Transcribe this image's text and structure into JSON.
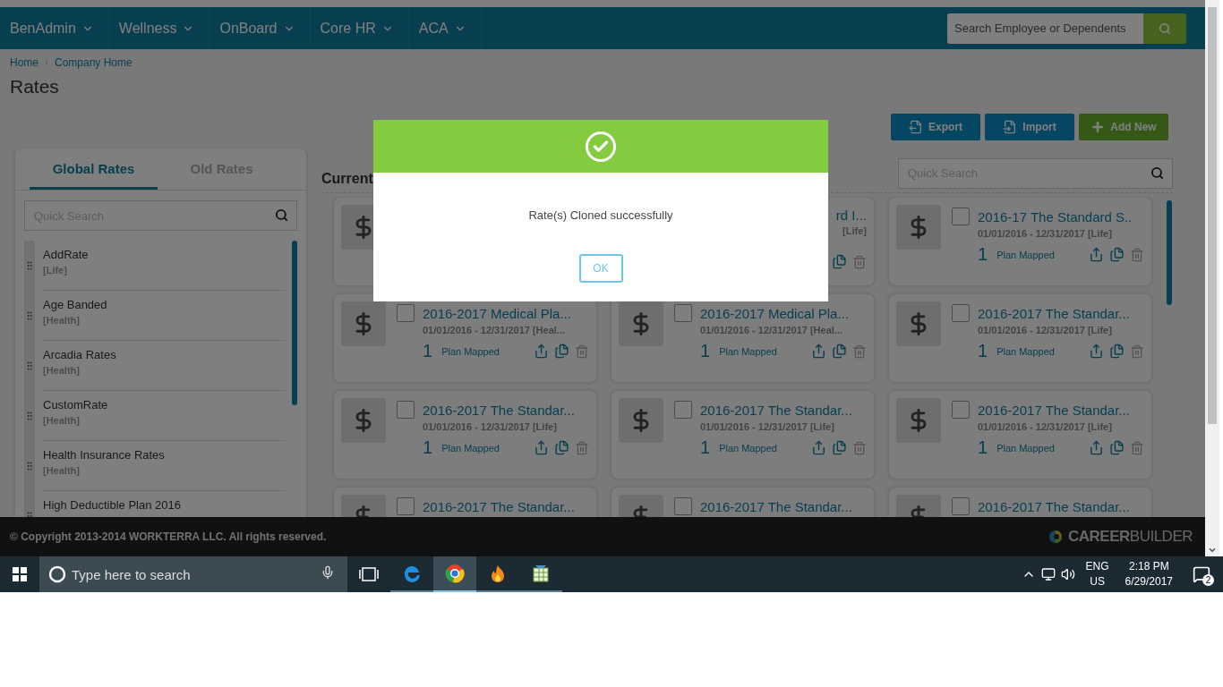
{
  "nav": {
    "items": [
      {
        "label": "BenAdmin"
      },
      {
        "label": "Wellness"
      },
      {
        "label": "OnBoard"
      },
      {
        "label": "Core HR"
      },
      {
        "label": "ACA"
      }
    ],
    "search": {
      "placeholder": "Search Employee or Dependents"
    }
  },
  "breadcrumb": [
    "Home",
    "Company Home"
  ],
  "page_title": "Rates",
  "toolbar": [
    {
      "kind": "export",
      "label": "Export"
    },
    {
      "kind": "import",
      "label": "Import"
    },
    {
      "kind": "add",
      "label": "Add New"
    }
  ],
  "sidebar": {
    "tabs": [
      {
        "label": "Global Rates",
        "selected": true
      },
      {
        "label": "Old Rates",
        "selected": false
      }
    ],
    "search": {
      "placeholder": "Quick Search"
    },
    "items": [
      {
        "name": "AddRate",
        "type": "[Life]"
      },
      {
        "name": "Age Banded",
        "type": "[Health]"
      },
      {
        "name": "Arcadia Rates",
        "type": "[Health]"
      },
      {
        "name": "CustomRate",
        "type": "[Health]"
      },
      {
        "name": "Health Insurance Rates",
        "type": "[Health]"
      },
      {
        "name": "High Deductible Plan 2016"
      }
    ]
  },
  "current": {
    "heading": "Current",
    "search": {
      "placeholder": "Quick Search"
    },
    "cards": [
      {
        "kind": "covered"
      },
      {
        "kind": "partial",
        "title": "rd I...",
        "date": "[Life]"
      },
      {
        "kind": "full",
        "checked": false,
        "title": "2016-17 The Standard S..",
        "date": "01/01/2016 - 12/31/2017 [Life]",
        "count": "1",
        "count_label": "Plan Mapped"
      },
      {
        "kind": "full",
        "checked": false,
        "title": "2016-2017 Medical Pla...",
        "date": "01/01/2016 - 12/31/2017 [Heal...",
        "count": "1",
        "count_label": "Plan Mapped"
      },
      {
        "kind": "full",
        "checked": false,
        "title": "2016-2017 Medical Pla...",
        "date": "01/01/2016 - 12/31/2017 [Heal...",
        "count": "1",
        "count_label": "Plan Mapped"
      },
      {
        "kind": "full",
        "checked": false,
        "title": "2016-2017 The Standar...",
        "date": "01/01/2016 - 12/31/2017 [Life]",
        "count": "1",
        "count_label": "Plan Mapped"
      },
      {
        "kind": "full",
        "checked": false,
        "title": "2016-2017 The Standar...",
        "date": "01/01/2016 - 12/31/2017 [Life]",
        "count": "1",
        "count_label": "Plan Mapped"
      },
      {
        "kind": "full",
        "checked": false,
        "title": "2016-2017 The Standar...",
        "date": "01/01/2016 - 12/31/2017 [Life]",
        "count": "1",
        "count_label": "Plan Mapped"
      },
      {
        "kind": "full",
        "checked": false,
        "title": "2016-2017 The Standar...",
        "date": "01/01/2016 - 12/31/2017 [Life]",
        "count": "1",
        "count_label": "Plan Mapped"
      },
      {
        "kind": "cut",
        "checked": false,
        "title": "2016-2017 The Standar..."
      },
      {
        "kind": "cut",
        "checked": false,
        "title": "2016-2017 The Standar..."
      },
      {
        "kind": "cut",
        "checked": false,
        "title": "2016-2017 The Standar..."
      }
    ]
  },
  "footer": {
    "copyright": "© Copyright 2013-2014 WORKTERRA LLC. All rights reserved.",
    "logo": "**CAREER**BUILDER"
  },
  "modal": {
    "message": "Rate(s) Cloned successfully",
    "button": "OK"
  },
  "taskbar": {
    "search_placeholder": "Type here to search",
    "apps": [
      {
        "kind": "edge",
        "selected": false
      },
      {
        "kind": "chrome",
        "selected": true
      },
      {
        "kind": "flame",
        "selected": false
      },
      {
        "kind": "sheet",
        "selected": false
      }
    ],
    "language": [
      "ENG",
      "US"
    ],
    "time": "2:18 PM",
    "date": "6/29/2017",
    "notifications": "2"
  }
}
